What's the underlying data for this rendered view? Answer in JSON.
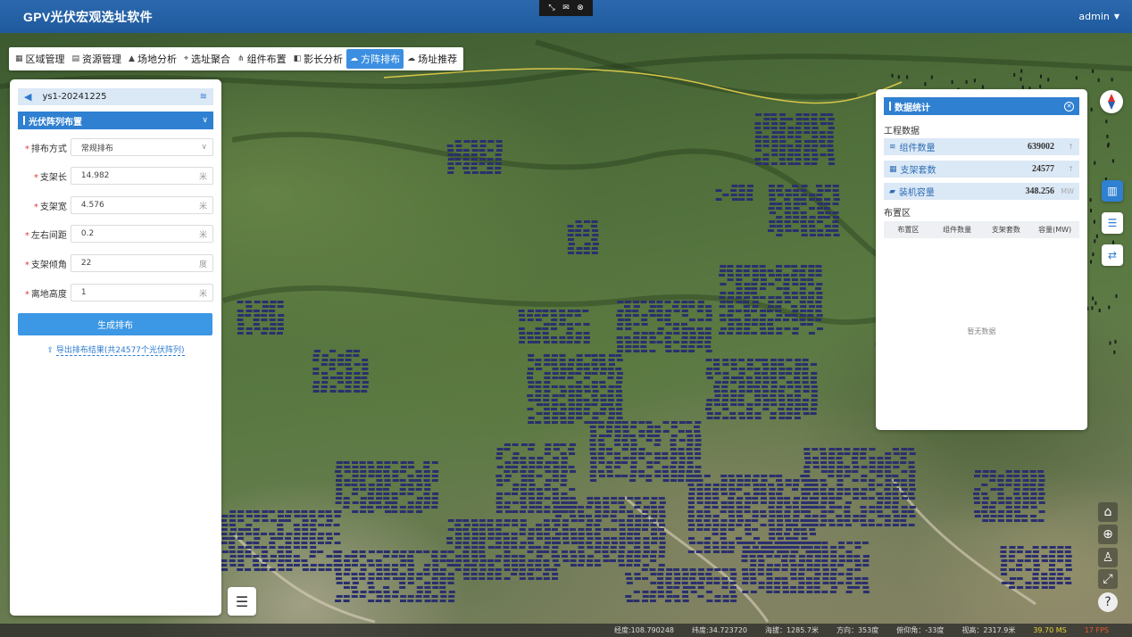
{
  "app": {
    "title": "GPV光伏宏观选址软件",
    "user": "admin"
  },
  "toolbar": {
    "items": [
      {
        "label": "区域管理",
        "icon": "area-icon"
      },
      {
        "label": "资源管理",
        "icon": "resource-icon"
      },
      {
        "label": "场地分析",
        "icon": "terrain-icon"
      },
      {
        "label": "选址聚合",
        "icon": "location-pin-icon"
      },
      {
        "label": "组件布置",
        "icon": "component-layout-icon"
      },
      {
        "label": "影长分析",
        "icon": "shadow-icon"
      },
      {
        "label": "方阵排布",
        "icon": "array-layout-icon",
        "active": true
      },
      {
        "label": "场址推荐",
        "icon": "site-recommend-icon"
      }
    ]
  },
  "left_panel": {
    "project_name": "ys1-20241225",
    "section_title": "光伏阵列布置",
    "fields": [
      {
        "label": "排布方式",
        "value": "常规排布",
        "unit": "",
        "type": "select"
      },
      {
        "label": "支架长",
        "value": "14.982",
        "unit": "米"
      },
      {
        "label": "支架宽",
        "value": "4.576",
        "unit": "米"
      },
      {
        "label": "左右间距",
        "value": "0.2",
        "unit": "米"
      },
      {
        "label": "支架倾角",
        "value": "22",
        "unit": "度"
      },
      {
        "label": "离地高度",
        "value": "1",
        "unit": "米"
      }
    ],
    "generate_button": "生成排布",
    "export_link": "导出排布结果(共24577个光伏阵列)"
  },
  "stats_panel": {
    "title": "数据统计",
    "project_data_label": "工程数据",
    "rows": [
      {
        "label": "组件数量",
        "value": "639002",
        "unit": ""
      },
      {
        "label": "支架套数",
        "value": "24577",
        "unit": ""
      },
      {
        "label": "装机容量",
        "value": "348.256",
        "unit": "MW"
      }
    ],
    "layout_area_label": "布置区",
    "table_headers": [
      "布置区",
      "组件数量",
      "支架套数",
      "容量(MW)"
    ],
    "no_data": "暂无数据"
  },
  "status_bar": {
    "longitude": "经度:108.790248",
    "latitude": "纬度:34.723720",
    "altitude": "海拔：1285.7米",
    "heading": "方向：353度",
    "pitch": "俯仰角：-33度",
    "view_height": "视高：2317.9米",
    "ms": "39.70 MS",
    "fps": "17 FPS"
  },
  "colors": {
    "topbar": "#2b68ad",
    "accent": "#2f80d1",
    "active_tab": "#3c8fe0",
    "solar_panel": "#2a2f6e"
  }
}
